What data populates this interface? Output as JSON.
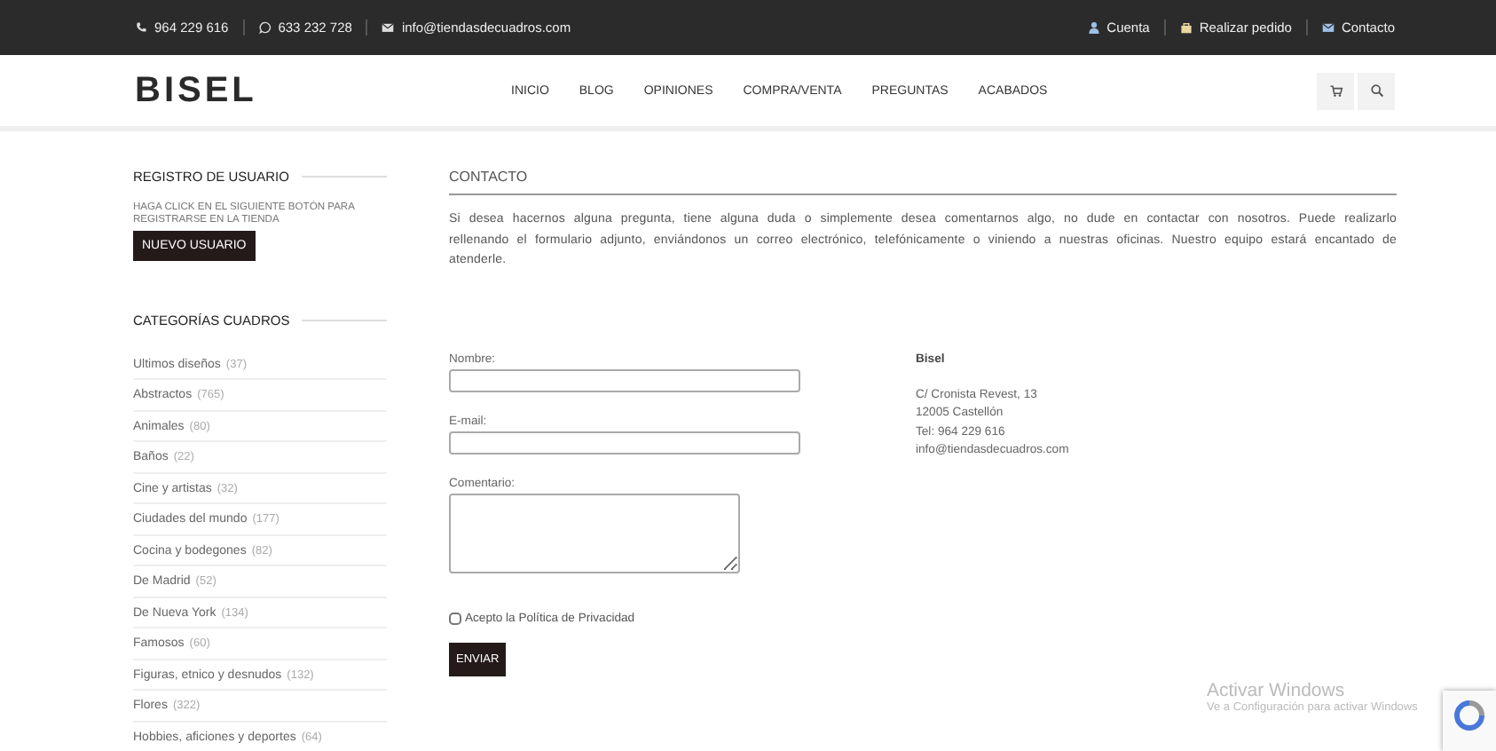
{
  "topbar": {
    "contacts": [
      {
        "kind": "phone",
        "text": "964 229 616"
      },
      {
        "kind": "whatsapp",
        "text": "633 232 728"
      },
      {
        "kind": "mail",
        "text": "info@tiendasdecuadros.com"
      }
    ],
    "links": [
      {
        "kind": "user",
        "text": "Cuenta"
      },
      {
        "kind": "bag",
        "text": "Realizar pedido"
      },
      {
        "kind": "mail",
        "text": "Contacto"
      }
    ]
  },
  "header": {
    "logo": "BISEL",
    "nav": [
      "INICIO",
      "BLOG",
      "OPINIONES",
      "COMPRA/VENTA",
      "PREGUNTAS",
      "ACABADOS"
    ],
    "tools": [
      {
        "kind": "cart"
      },
      {
        "kind": "search"
      }
    ]
  },
  "sidebar": {
    "register": {
      "title": "REGISTRO DE USUARIO",
      "text": "HAGA CLICK EN EL SIGUIENTE BOTÓN PARA REGISTRARSE EN LA TIENDA",
      "button": "NUEVO USUARIO"
    },
    "categories": {
      "title": "CATEGORÍAS CUADROS",
      "items": [
        {
          "name": "Ultimos diseños",
          "count": "(37)"
        },
        {
          "name": "Abstractos",
          "count": "(765)"
        },
        {
          "name": "Animales",
          "count": "(80)"
        },
        {
          "name": "Baños",
          "count": "(22)"
        },
        {
          "name": "Cine y artistas",
          "count": "(32)"
        },
        {
          "name": "Ciudades del mundo",
          "count": "(177)"
        },
        {
          "name": "Cocina y bodegones",
          "count": "(82)"
        },
        {
          "name": "De Madrid",
          "count": "(52)"
        },
        {
          "name": "De Nueva York",
          "count": "(134)"
        },
        {
          "name": "Famosos",
          "count": "(60)"
        },
        {
          "name": "Figuras, etnico y desnudos",
          "count": "(132)"
        },
        {
          "name": "Flores",
          "count": "(322)"
        },
        {
          "name": "Hobbies, aficiones y deportes",
          "count": "(64)"
        }
      ]
    }
  },
  "contact": {
    "title": "CONTACTO",
    "intro": "Si desea hacernos alguna pregunta, tiene alguna duda o simplemente desea comentarnos algo, no dude en contactar con nosotros. Puede realizarlo rellenando el formulario adjunto, enviándonos un correo electrónico, telefónicamente o viniendo a nuestras oficinas. Nuestro equipo estará encantado de atenderle.",
    "fields": [
      {
        "kind": "input",
        "label": "Nombre:"
      },
      {
        "kind": "input",
        "label": "E-mail:"
      },
      {
        "kind": "textarea",
        "label": "Comentario:"
      }
    ],
    "privacy": {
      "label": "Acepto la Política de Privacidad",
      "checked": false
    },
    "submit": "ENVIAR",
    "company": {
      "name": "Bisel",
      "lines": [
        "C/ Cronista Revest, 13",
        "12005 Castellón",
        "Tel: 964 229 616",
        "info@tiendasdecuadros.com"
      ]
    }
  },
  "os_notice": {
    "title": "Activar Windows",
    "text": "Ve a Configuración para activar Windows"
  }
}
